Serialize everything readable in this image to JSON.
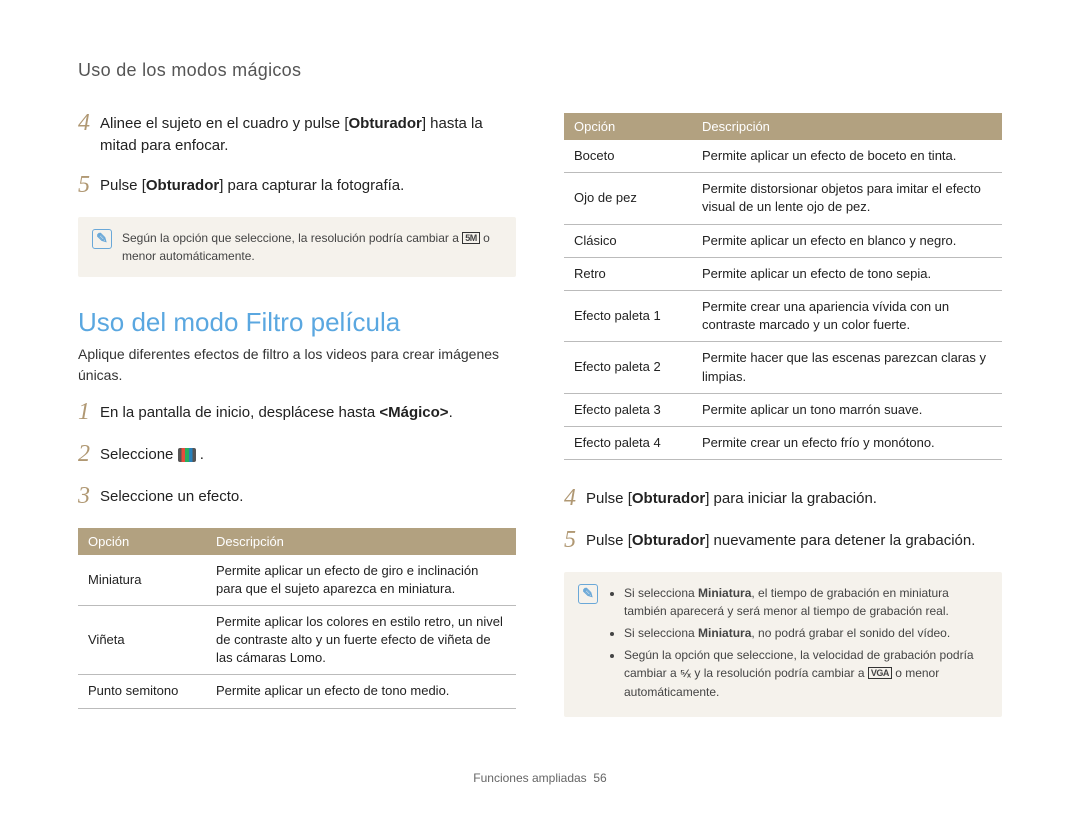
{
  "header": "Uso de los modos mágicos",
  "left": {
    "step4": {
      "num": "4",
      "text_pre": "Alinee el sujeto en el cuadro y pulse [",
      "bold": "Obturador",
      "text_post": "] hasta la mitad para enfocar."
    },
    "step5": {
      "num": "5",
      "text_pre": "Pulse [",
      "bold": "Obturador",
      "text_post": "] para capturar la fotografía."
    },
    "note1_pre": "Según la opción que seleccione, la resolución podría cambiar a ",
    "note1_badge": "5M",
    "note1_post": " o menor automáticamente.",
    "section_title": "Uso del modo Filtro película",
    "section_sub": "Aplique diferentes efectos de filtro a los videos para crear imágenes únicas.",
    "b1": {
      "num": "1",
      "text_pre": "En la pantalla de inicio, desplácese hasta ",
      "bold": "<Mágico>",
      "text_post": "."
    },
    "b2": {
      "num": "2",
      "text": "Seleccione "
    },
    "b3": {
      "num": "3",
      "text": "Seleccione un efecto."
    },
    "table": {
      "h1": "Opción",
      "h2": "Descripción",
      "rows": [
        {
          "opt": "Miniatura",
          "desc": "Permite aplicar un efecto de giro e inclinación para que el sujeto aparezca en miniatura."
        },
        {
          "opt": "Viñeta",
          "desc": "Permite aplicar los colores en estilo retro, un nivel de contraste alto y un fuerte efecto de viñeta de las cámaras Lomo."
        },
        {
          "opt": "Punto semitono",
          "desc": "Permite aplicar un efecto de tono medio."
        }
      ]
    }
  },
  "right": {
    "table": {
      "h1": "Opción",
      "h2": "Descripción",
      "rows": [
        {
          "opt": "Boceto",
          "desc": "Permite aplicar un efecto de boceto en tinta."
        },
        {
          "opt": "Ojo de pez",
          "desc": "Permite distorsionar objetos para imitar el efecto visual de un lente ojo de pez."
        },
        {
          "opt": "Clásico",
          "desc": "Permite aplicar un efecto en blanco y negro."
        },
        {
          "opt": "Retro",
          "desc": "Permite aplicar un efecto de tono sepia."
        },
        {
          "opt": "Efecto paleta 1",
          "desc": "Permite crear una apariencia vívida con un contraste marcado y un color fuerte."
        },
        {
          "opt": "Efecto paleta 2",
          "desc": "Permite hacer que las escenas parezcan claras y limpias."
        },
        {
          "opt": "Efecto paleta 3",
          "desc": "Permite aplicar un tono marrón suave."
        },
        {
          "opt": "Efecto paleta 4",
          "desc": "Permite crear un efecto frío y monótono."
        }
      ]
    },
    "step4": {
      "num": "4",
      "text_pre": "Pulse [",
      "bold": "Obturador",
      "text_post": "] para iniciar la grabación."
    },
    "step5": {
      "num": "5",
      "text_pre": "Pulse [",
      "bold": "Obturador",
      "text_post": "] nuevamente para detener la grabación."
    },
    "note": {
      "li1_pre": "Si selecciona ",
      "li1_b": "Miniatura",
      "li1_post": ", el tiempo de grabación en miniatura también aparecerá y será menor al tiempo de grabación real.",
      "li2_pre": "Si selecciona ",
      "li2_b": "Miniatura",
      "li2_post": ", no podrá grabar el sonido del vídeo.",
      "li3_pre": "Según la opción que seleccione, la velocidad de grabación podría cambiar a ",
      "li3_mid": " y la resolución podría cambiar a ",
      "li3_badge": "VGA",
      "li3_post": " o menor automáticamente."
    }
  },
  "footer": {
    "label": "Funciones ampliadas",
    "page": "56"
  }
}
